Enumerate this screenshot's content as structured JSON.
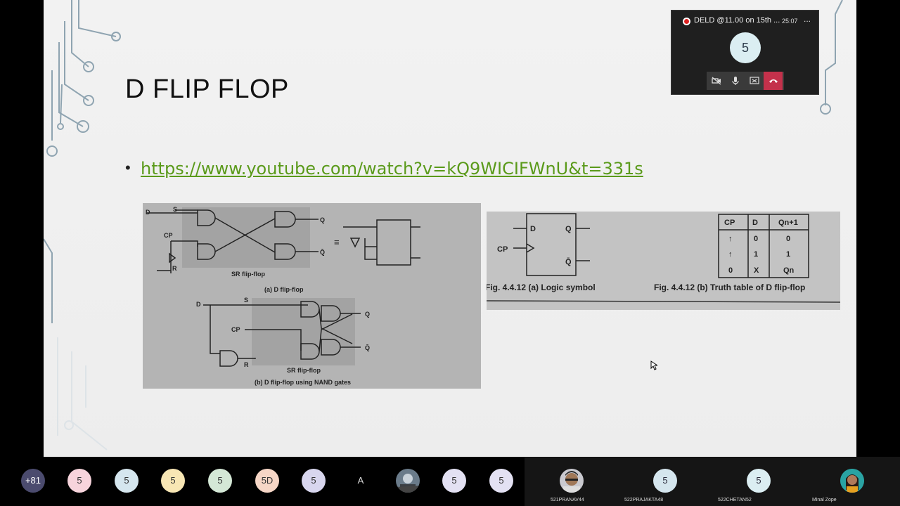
{
  "slide": {
    "title": "D FLIP FLOP",
    "bullet": "•",
    "link": "https://www.youtube.com/watch?v=kQ9WICIFWnU&t=331s",
    "figure_left": {
      "label_d": "D",
      "label_s": "S",
      "label_cp": "CP",
      "label_r": "R",
      "label_q": "Q",
      "label_qbar": "Q̄",
      "equiv": "≡",
      "sr_caption": "SR flip-flop",
      "caption_a": "(a) D flip-flop",
      "caption_b": "(b) D flip-flop using NAND gates"
    },
    "figure_right": {
      "caption_a": "Fig. 4.4.12 (a) Logic symbol",
      "caption_b": "Fig. 4.4.12 (b) Truth table of D flip-flop",
      "headers": [
        "CP",
        "D",
        "Qn+1"
      ],
      "rows": [
        [
          "↑",
          "0",
          "0"
        ],
        [
          "↑",
          "1",
          "1"
        ],
        [
          "0",
          "X",
          "Qn"
        ]
      ]
    }
  },
  "call_window": {
    "title": "DELD @11.00 on 15th ...",
    "timer": "25:07",
    "more": "...",
    "avatar": "5",
    "icons": [
      "video-off-icon",
      "microphone-icon",
      "share-screen-icon",
      "hang-up-icon"
    ],
    "end_color": "#c4314b"
  },
  "participants": {
    "chips": [
      {
        "text": "+81",
        "color": "#4b4b6e",
        "fg": "#ffffff"
      },
      {
        "text": "5",
        "color": "#f7d4dc",
        "fg": "#333333"
      },
      {
        "text": "5",
        "color": "#d5e6ee",
        "fg": "#333333"
      },
      {
        "text": "5",
        "color": "#f8e6b4",
        "fg": "#333333"
      },
      {
        "text": "5",
        "color": "#d4e8d6",
        "fg": "#333333"
      },
      {
        "text": "5D",
        "color": "#f6d6c6",
        "fg": "#333333"
      },
      {
        "text": "5",
        "color": "#d8d6ee",
        "fg": "#333333"
      },
      {
        "text": "A",
        "color": "#000000",
        "fg": "#dddddd"
      },
      {
        "text": "",
        "color": "#6a7b8a",
        "fg": "#ffffff"
      },
      {
        "text": "5",
        "color": "#e3e1f3",
        "fg": "#333333"
      },
      {
        "text": "5",
        "color": "#e3e1f3",
        "fg": "#333333"
      }
    ],
    "tiles": [
      {
        "name": "521PRANAV44",
        "avatar": "photo"
      },
      {
        "name": "522PRAJAKTA48",
        "avatar": "5"
      },
      {
        "name": "522CHETAN52",
        "avatar": "5"
      },
      {
        "name": "Minal Zope",
        "avatar": "photo"
      }
    ]
  }
}
